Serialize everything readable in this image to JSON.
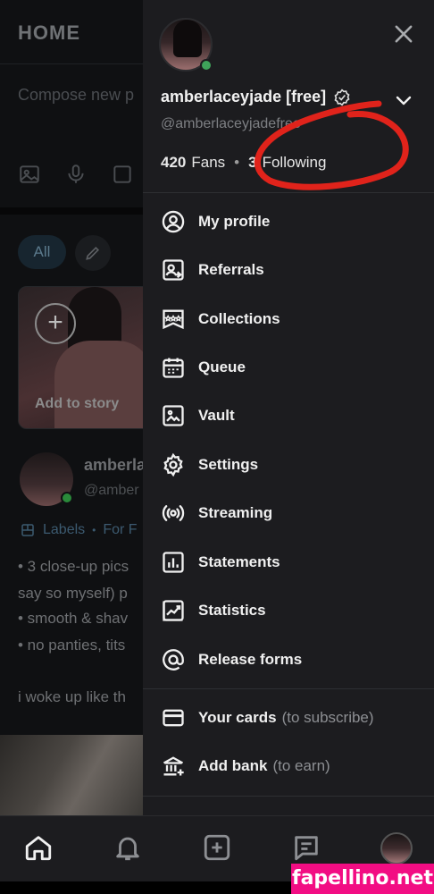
{
  "feed": {
    "title": "HOME",
    "compose_placeholder": "Compose new p",
    "chip_all": "All",
    "story_label": "Add to story",
    "post": {
      "name": "amberla",
      "handle": "@amber",
      "labels": "Labels",
      "labels_sep": "•",
      "labels_more": "For F",
      "lines": [
        "• 3 close-up pics",
        "say so myself) p",
        "• smooth & shav",
        "• no panties, tits",
        "",
        "i woke up like th"
      ]
    }
  },
  "drawer": {
    "display_name": "amberlaceyjade [free]",
    "handle": "@amberlaceyjadefree",
    "fans_count": "420",
    "fans_label": "Fans",
    "following_count": "3",
    "following_label": "Following",
    "stats_sep": "•",
    "menu": [
      {
        "label": "My profile",
        "icon": "user-circle-icon"
      },
      {
        "label": "Referrals",
        "icon": "referral-icon"
      },
      {
        "label": "Collections",
        "icon": "collections-icon"
      },
      {
        "label": "Queue",
        "icon": "calendar-icon"
      },
      {
        "label": "Vault",
        "icon": "vault-image-icon"
      },
      {
        "label": "Settings",
        "icon": "gear-icon"
      },
      {
        "label": "Streaming",
        "icon": "broadcast-icon"
      },
      {
        "label": "Statements",
        "icon": "bar-chart-icon"
      },
      {
        "label": "Statistics",
        "icon": "trend-chart-icon"
      },
      {
        "label": "Release forms",
        "icon": "at-sign-icon"
      }
    ],
    "payments": [
      {
        "label": "Your cards",
        "hint": "(to subscribe)",
        "icon": "credit-card-icon"
      },
      {
        "label": "Add bank",
        "hint": "(to earn)",
        "icon": "bank-icon"
      }
    ]
  },
  "watermark": "fapellino.net",
  "colors": {
    "drawer_bg": "#1c1c1f",
    "feed_bg": "#0f1012",
    "accent_red": "#e0231b",
    "online_green": "#3fa35a",
    "watermark_pink": "#f20d83"
  }
}
